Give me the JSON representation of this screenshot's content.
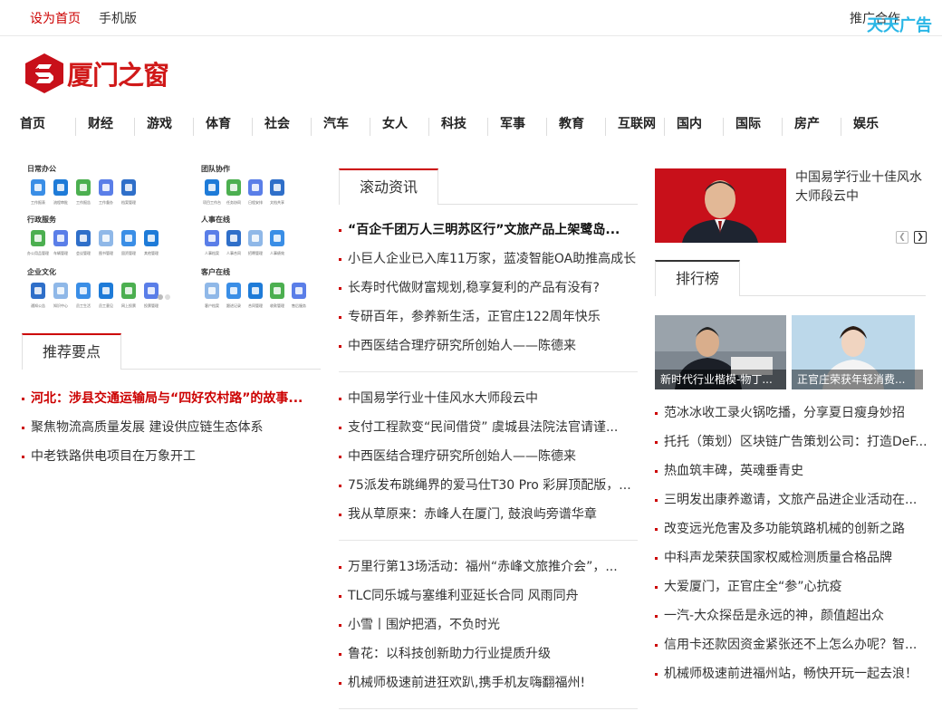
{
  "topbar": {
    "set_home": "设为首页",
    "mobile": "手机版",
    "cooperation": "推广合作",
    "ad_label": "天天广告"
  },
  "logo": {
    "text": "厦门之窗"
  },
  "nav": [
    "首页",
    "财经",
    "游戏",
    "体育",
    "社会",
    "汽车",
    "女人",
    "科技",
    "军事",
    "教育",
    "互联网",
    "国内",
    "国际",
    "房产",
    "娱乐"
  ],
  "office_panel": {
    "groups": [
      {
        "title": "日常办公",
        "items": [
          "工作报表",
          "流程审批",
          "工作报告",
          "工作督办",
          "档案管理"
        ]
      },
      {
        "title": "团队协作",
        "items": [
          "项目工作台",
          "任务协同",
          "日程安排",
          "文档共享"
        ]
      },
      {
        "title": "行政服务",
        "items": [
          "办公用品管理",
          "车辆管理",
          "会议管理",
          "图书管理",
          "固资管理",
          "其他管理"
        ]
      },
      {
        "title": "人事在线",
        "items": [
          "人事档案",
          "人事合同",
          "招聘管理",
          "人事绩效"
        ]
      },
      {
        "title": "企业文化",
        "items": [
          "通知公告",
          "知识中心",
          "员工生活",
          "员工意见",
          "网上投票",
          "投票管理"
        ]
      },
      {
        "title": "客户在线",
        "items": [
          "客户档案",
          "跟进记录",
          "合同管理",
          "收款管理",
          "售后服务"
        ]
      }
    ]
  },
  "recommend": {
    "heading": "推荐要点",
    "items": [
      "河北：涉县交通运输局与“四好农村路”的故事...",
      "聚焦物流高质量发展 建设供应链生态体系",
      "中老铁路供电项目在万象开工"
    ]
  },
  "scroll_news": {
    "heading": "滚动资讯",
    "groups": [
      [
        "“百企千团万人三明苏区行”文旅产品上架鹭岛...",
        "小巨人企业已入库11万家，蓝凌智能OA助推高成长",
        "长寿时代做财富规划,稳享复利的产品有没有?",
        "专研百年，参养新生活，正官庄122周年快乐",
        "中西医结合理疗研究所创始人——陈德来"
      ],
      [
        "中国易学行业十佳风水大师段云中",
        "支付工程款变“民间借贷” 虞城县法院法官请谨...",
        "中西医结合理疗研究所创始人——陈德来",
        "75派发布跳绳界的爱马仕T30 Pro 彩屏顶配版，...",
        "我从草原来：赤峰人在厦门, 鼓浪屿旁谱华章"
      ],
      [
        "万里行第13场活动：福州“赤峰文旅推介会”，...",
        "TLC同乐城与塞维利亚延长合同 风雨同舟",
        "小雪丨围炉把酒，不负时光",
        "鲁花：以科技创新助力行业提质升级",
        "机械师极速前进狂欢趴,携手机友嗨翻福州!"
      ]
    ]
  },
  "feature": {
    "title": "中国易学行业十佳风水大师段云中",
    "prev_icon": "chevron-left-icon",
    "next_icon": "chevron-right-icon"
  },
  "ranking": {
    "heading": "排行榜",
    "thumbs": [
      "新时代行业楷模-物丁...",
      "正官庄荣获年轻消费..."
    ],
    "items": [
      "范冰冰收工录火锅吃播，分享夏日瘦身妙招",
      "托托（策划）区块链广告策划公司：打造DeF...",
      "热血筑丰碑，英魂垂青史",
      "三明发出康养邀请，文旅产品进企业活动在...",
      "改变远光危害及多功能筑路机械的创新之路",
      "中科声龙荣获国家权威检测质量合格品牌",
      "大爱厦门，正官庄全“参”心抗疫",
      "一汽-大众探岳是永远的神，颜值超出众",
      "信用卡还款因资金紧张还不上怎么办呢？智...",
      "机械师极速前进福州站，畅快开玩一起去浪！"
    ]
  }
}
